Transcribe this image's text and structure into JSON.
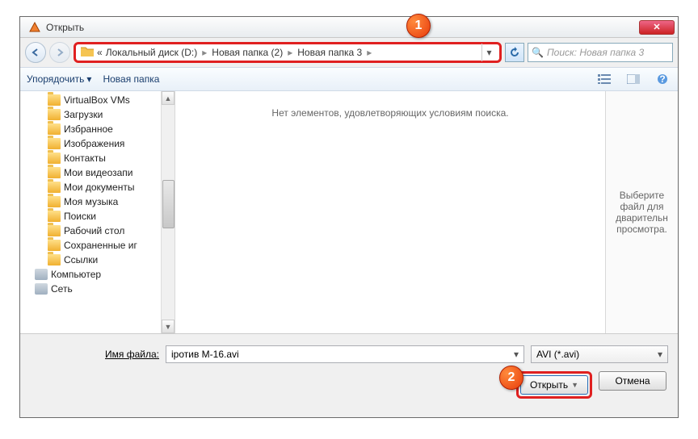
{
  "window": {
    "title": "Открыть"
  },
  "breadcrumb": {
    "prefix": "«",
    "items": [
      "Локальный диск (D:)",
      "Новая папка (2)",
      "Новая папка 3"
    ]
  },
  "search": {
    "placeholder": "Поиск: Новая папка 3"
  },
  "toolbar": {
    "organize": "Упорядочить",
    "newfolder": "Новая папка"
  },
  "tree": {
    "items": [
      {
        "lvl": 1,
        "kind": "f",
        "label": "VirtualBox VMs"
      },
      {
        "lvl": 1,
        "kind": "f",
        "label": "Загрузки"
      },
      {
        "lvl": 1,
        "kind": "f",
        "label": "Избранное"
      },
      {
        "lvl": 1,
        "kind": "f",
        "label": "Изображения"
      },
      {
        "lvl": 1,
        "kind": "f",
        "label": "Контакты"
      },
      {
        "lvl": 1,
        "kind": "f",
        "label": "Мои видеозапи"
      },
      {
        "lvl": 1,
        "kind": "f",
        "label": "Мои документы"
      },
      {
        "lvl": 1,
        "kind": "f",
        "label": "Моя музыка"
      },
      {
        "lvl": 1,
        "kind": "f",
        "label": "Поиски"
      },
      {
        "lvl": 1,
        "kind": "f",
        "label": "Рабочий стол"
      },
      {
        "lvl": 1,
        "kind": "f",
        "label": "Сохраненные иг"
      },
      {
        "lvl": 1,
        "kind": "f",
        "label": "Ссылки"
      },
      {
        "lvl": 0,
        "kind": "c",
        "label": "Компьютер"
      },
      {
        "lvl": 0,
        "kind": "c",
        "label": "Сеть"
      }
    ]
  },
  "main": {
    "empty": "Нет элементов, удовлетворяющих условиям поиска."
  },
  "preview": {
    "text": "Выберите файл для дварительн просмотра."
  },
  "footer": {
    "filename_label": "Имя файла:",
    "filename_value": "іротив М-16.avi",
    "filetype": "AVI (*.avi)",
    "open": "Открыть",
    "cancel": "Отмена"
  },
  "markers": {
    "m1": "1",
    "m2": "2"
  }
}
